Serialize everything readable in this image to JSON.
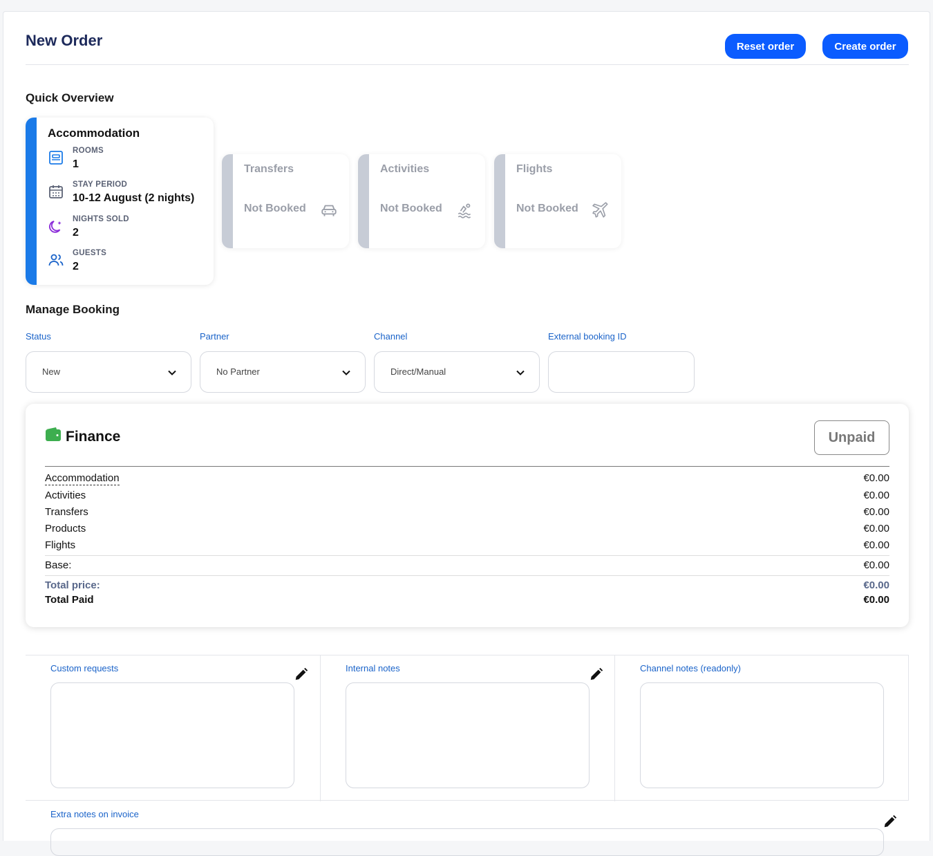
{
  "header": {
    "title": "New Order",
    "reset_label": "Reset order",
    "create_label": "Create order"
  },
  "quick_overview": {
    "title": "Quick Overview",
    "accommodation": {
      "title": "Accommodation",
      "rows": [
        {
          "label": "ROOMS",
          "value": "1",
          "icon": "bed-icon"
        },
        {
          "label": "STAY PERIOD",
          "value": "10-12 August (2 nights)",
          "icon": "calendar-icon"
        },
        {
          "label": "NIGHTS SOLD",
          "value": "2",
          "icon": "moon-icon"
        },
        {
          "label": "GUESTS",
          "value": "2",
          "icon": "users-icon"
        }
      ]
    },
    "services": [
      {
        "title": "Transfers",
        "status": "Not Booked",
        "icon": "car-icon"
      },
      {
        "title": "Activities",
        "status": "Not Booked",
        "icon": "swimmer-icon"
      },
      {
        "title": "Flights",
        "status": "Not Booked",
        "icon": "plane-icon"
      }
    ]
  },
  "manage_booking": {
    "title": "Manage Booking",
    "status": {
      "label": "Status",
      "value": "New"
    },
    "partner": {
      "label": "Partner",
      "value": "No Partner"
    },
    "channel": {
      "label": "Channel",
      "value": "Direct/Manual"
    },
    "external_id": {
      "label": "External booking ID",
      "value": ""
    }
  },
  "finance": {
    "title": "Finance",
    "badge": "Unpaid",
    "items": [
      {
        "label": "Accommodation",
        "value": "€0.00"
      },
      {
        "label": "Activities",
        "value": "€0.00"
      },
      {
        "label": "Transfers",
        "value": "€0.00"
      },
      {
        "label": "Products",
        "value": "€0.00"
      },
      {
        "label": "Flights",
        "value": "€0.00"
      }
    ],
    "base_label": "Base:",
    "base_value": "€0.00",
    "total_price_label": "Total price:",
    "total_price_value": "€0.00",
    "total_paid_label": "Total Paid",
    "total_paid_value": "€0.00"
  },
  "notes": {
    "custom_requests": "Custom requests",
    "internal_notes": "Internal notes",
    "channel_notes": "Channel notes (readonly)",
    "extra_notes": "Extra notes on invoice"
  },
  "colors": {
    "accent": "#0b5cff",
    "accommodation_bar": "#1a7ae8",
    "inactive_bar": "#c7ccd6",
    "label_blue": "#1a63c9",
    "wallet_green": "#3dae4f"
  }
}
